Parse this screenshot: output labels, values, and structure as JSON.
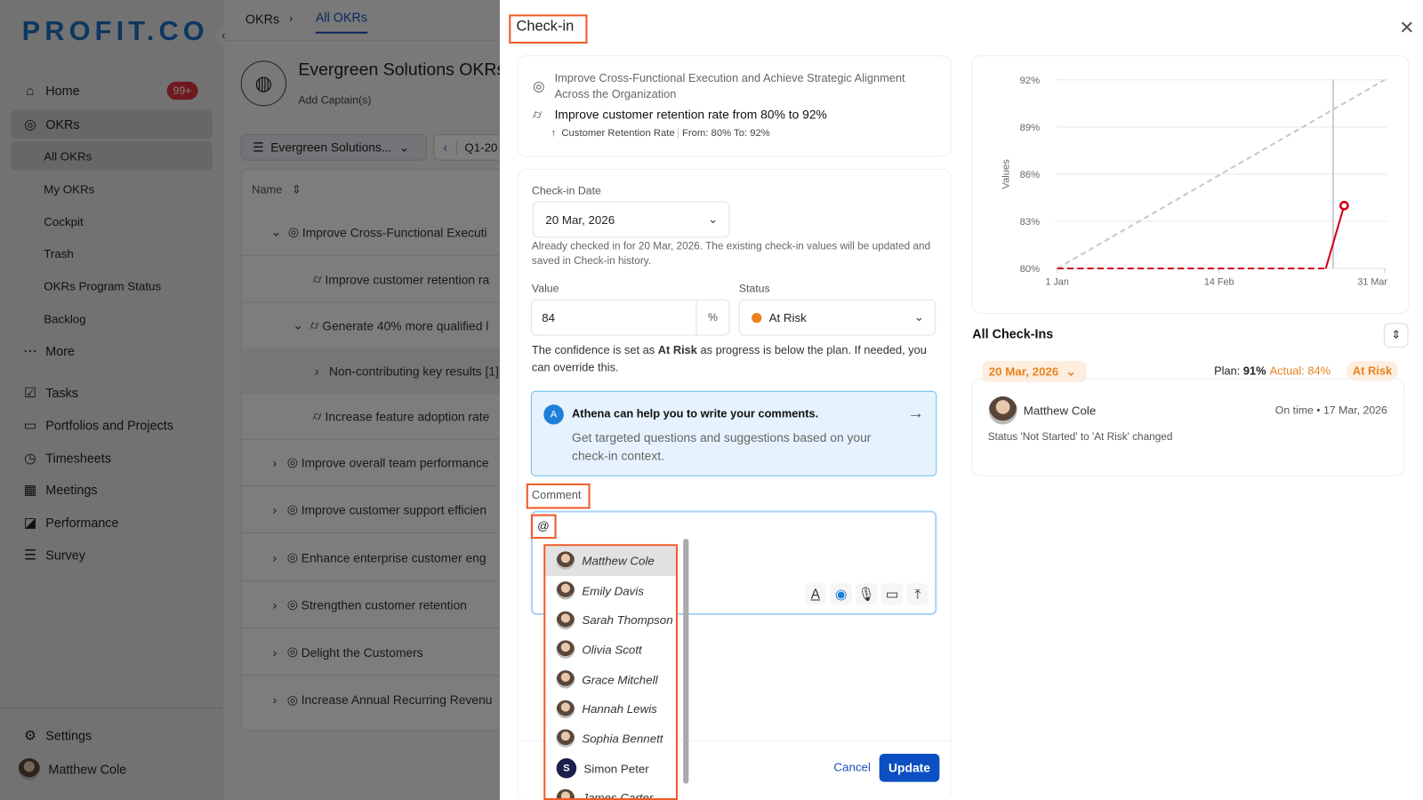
{
  "brand": {
    "logo": "PROFIT.CO"
  },
  "sidebar": {
    "items": [
      {
        "label": "Home",
        "icon": "home-icon",
        "badge": "99+"
      },
      {
        "label": "OKRs",
        "icon": "target-icon"
      },
      {
        "label": "All OKRs"
      },
      {
        "label": "My OKRs"
      },
      {
        "label": "Cockpit"
      },
      {
        "label": "Trash"
      },
      {
        "label": "OKRs Program Status"
      },
      {
        "label": "Backlog"
      },
      {
        "label": "More",
        "icon": "more-icon"
      },
      {
        "label": "Tasks",
        "icon": "tasks-icon"
      },
      {
        "label": "Portfolios and Projects",
        "icon": "briefcase-icon"
      },
      {
        "label": "Timesheets",
        "icon": "clock-icon"
      },
      {
        "label": "Meetings",
        "icon": "calendar-icon"
      },
      {
        "label": "Performance",
        "icon": "chart-icon"
      },
      {
        "label": "Survey",
        "icon": "survey-icon"
      }
    ],
    "settings": "Settings",
    "user": "Matthew Cole"
  },
  "main": {
    "breadcrumb": [
      "OKRs",
      "All OKRs"
    ],
    "title": "Evergreen Solutions OKRs",
    "add_captain": "Add Captain(s)",
    "filter": "Evergreen Solutions...",
    "period": "Q1-20",
    "col_name": "Name",
    "rows": [
      "Improve Cross-Functional Executi",
      "Improve customer retention ra",
      "Generate 40% more qualified l",
      "Non-contributing key results [1]",
      "Increase feature adoption rate",
      "Improve overall team performance",
      "Improve customer support efficien",
      "Enhance enterprise customer eng",
      "Strengthen customer retention",
      "Delight the Customers",
      "Increase Annual Recurring Revenu"
    ]
  },
  "checkin": {
    "title": "Check-in",
    "objective": "Improve Cross-Functional Execution and Achieve Strategic Alignment Across the Organization",
    "key_result": "Improve customer retention rate from 80% to 92%",
    "metric": "Customer Retention Rate",
    "range": "From: 80% To: 92%",
    "date_label": "Check-in Date",
    "date_value": "20 Mar, 2026",
    "date_note": "Already checked in for 20 Mar, 2026. The existing check-in values will be updated and saved in Check-in history.",
    "value_label": "Value",
    "value": "84",
    "unit": "%",
    "status_label": "Status",
    "status": "At Risk",
    "status_color": "#e8821e",
    "conf_pre": "The confidence is set as ",
    "conf_bold": "At Risk",
    "conf_post": " as progress is below the plan. If needed, you can override this.",
    "athena_title": "Athena can help you to write your comments.",
    "athena_body": "Get targeted questions and suggestions based on your check-in context.",
    "comment_label": "Comment",
    "comment_value": "@",
    "mentions": [
      "Matthew Cole",
      "Emily Davis",
      "Sarah Thompson",
      "Olivia Scott",
      "Grace Mitchell",
      "Hannah Lewis",
      "Sophia Bennett",
      "Simon Peter",
      "James Carter"
    ],
    "simon_initial": "S",
    "cancel": "Cancel",
    "update": "Update"
  },
  "chart_data": {
    "type": "line",
    "ylabel": "Values",
    "ylim": [
      80,
      92
    ],
    "yticks": [
      "80%",
      "83%",
      "86%",
      "89%",
      "92%"
    ],
    "xticks": [
      "1 Jan",
      "14 Feb",
      "31 Mar"
    ],
    "series": [
      {
        "role": "plan",
        "style": "dashed-gray",
        "points": [
          [
            "2026-01-01",
            80
          ],
          [
            "2026-03-31",
            92
          ]
        ]
      },
      {
        "role": "actual",
        "color": "#d0021b",
        "points": [
          [
            "2026-01-01",
            80
          ],
          [
            "2026-03-15",
            80
          ],
          [
            "2026-03-20",
            84
          ]
        ]
      }
    ],
    "today_marker": "2026-03-17"
  },
  "history": {
    "title": "All Check-Ins",
    "date": "20 Mar, 2026",
    "plan_label": "Plan: ",
    "plan": "91%",
    "actual": "Actual: 84%",
    "status": "At Risk",
    "user": "Matthew Cole",
    "when": "On time • 17 Mar, 2026",
    "change": "Status 'Not Started' to 'At Risk' changed"
  }
}
